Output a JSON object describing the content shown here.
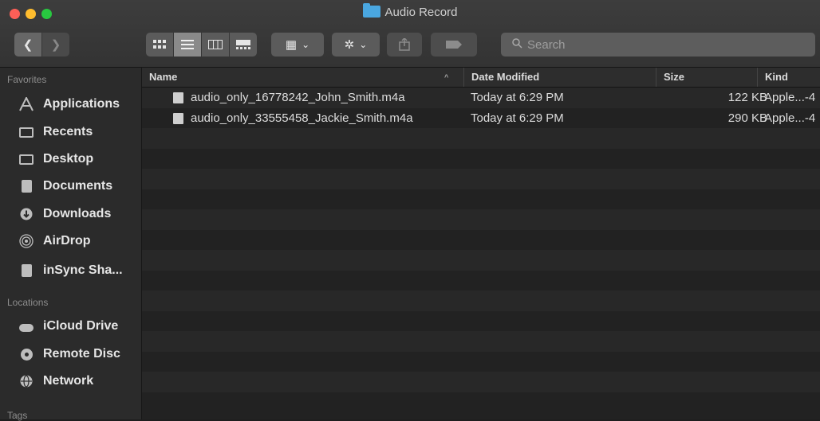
{
  "window": {
    "title": "Audio Record"
  },
  "toolbar": {
    "search_placeholder": "Search",
    "back_glyph": "❮",
    "forward_glyph": "❯",
    "group_glyph": "▦",
    "action_glyph": "✲",
    "chevron_glyph": "⌄"
  },
  "sidebar": {
    "favorites_title": "Favorites",
    "favorites": [
      {
        "label": "Applications",
        "icon": "applications-icon"
      },
      {
        "label": "Recents",
        "icon": "recents-icon"
      },
      {
        "label": "Desktop",
        "icon": "desktop-icon"
      },
      {
        "label": "Documents",
        "icon": "documents-icon"
      },
      {
        "label": "Downloads",
        "icon": "downloads-icon"
      },
      {
        "label": "AirDrop",
        "icon": "airdrop-icon"
      },
      {
        "label": "inSync Sha...",
        "icon": "document-icon"
      }
    ],
    "locations_title": "Locations",
    "locations": [
      {
        "label": "iCloud Drive",
        "icon": "cloud-icon"
      },
      {
        "label": "Remote Disc",
        "icon": "disc-icon"
      },
      {
        "label": "Network",
        "icon": "network-icon"
      }
    ],
    "tags_title": "Tags"
  },
  "columns": {
    "name": "Name",
    "date": "Date Modified",
    "size": "Size",
    "kind": "Kind"
  },
  "files": [
    {
      "name": "audio_only_16778242_John_Smith.m4a",
      "date": "Today at 6:29 PM",
      "size": "122 KB",
      "kind": "Apple...-4"
    },
    {
      "name": "audio_only_33555458_Jackie_Smith.m4a",
      "date": "Today at 6:29 PM",
      "size": "290 KB",
      "kind": "Apple...-4"
    }
  ]
}
